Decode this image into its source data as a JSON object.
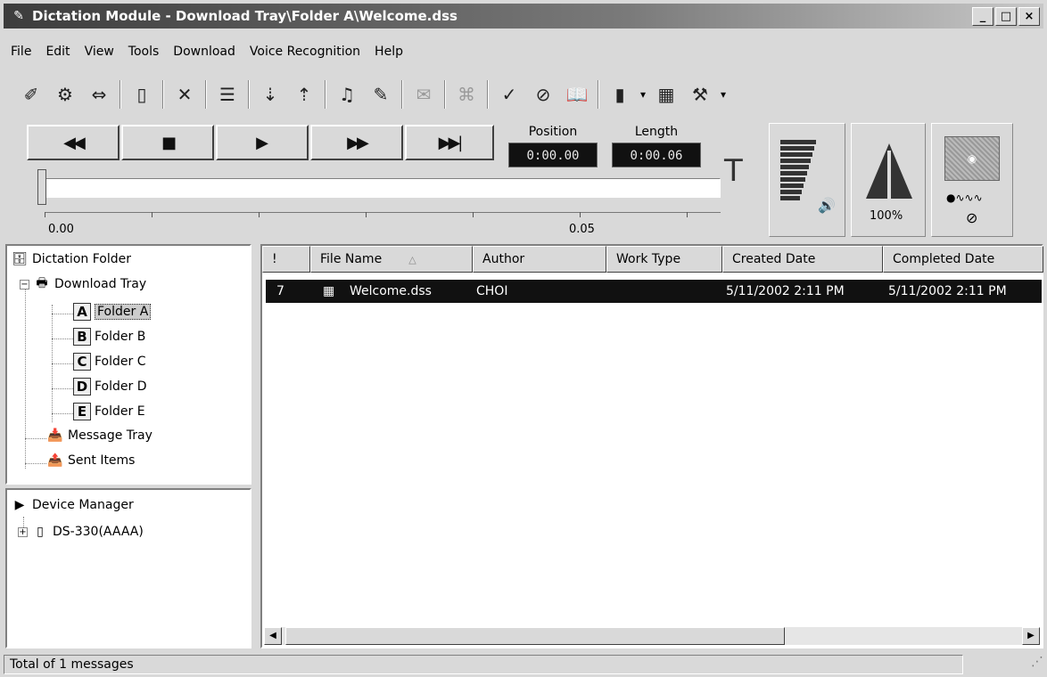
{
  "window": {
    "title": "Dictation Module - Download Tray\\Folder A\\Welcome.dss",
    "min": "_",
    "max": "□",
    "close": "×"
  },
  "menu": [
    "File",
    "Edit",
    "View",
    "Tools",
    "Download",
    "Voice Recognition",
    "Help"
  ],
  "player": {
    "position_label": "Position",
    "position_value": "0:00.00",
    "length_label": "Length",
    "length_value": "0:00.06",
    "scale_start": "0.00",
    "scale_mid": "0.05",
    "speed_value": "100%"
  },
  "tree": {
    "root": "Dictation Folder",
    "download_tray": "Download Tray",
    "folders": [
      {
        "letter": "A",
        "label": "Folder A"
      },
      {
        "letter": "B",
        "label": "Folder B"
      },
      {
        "letter": "C",
        "label": "Folder C"
      },
      {
        "letter": "D",
        "label": "Folder D"
      },
      {
        "letter": "E",
        "label": "Folder E"
      }
    ],
    "message_tray": "Message Tray",
    "sent_items": "Sent Items"
  },
  "devices": {
    "root": "Device Manager",
    "device": "DS-330(AAAA)"
  },
  "list": {
    "columns": [
      "!",
      "File Name",
      "Author",
      "Work Type",
      "Created Date",
      "Completed Date"
    ],
    "rows": [
      {
        "priority": "7",
        "file_name": "Welcome.dss",
        "author": "CHOI",
        "work_type": "",
        "created": "5/11/2002 2:11 PM",
        "completed": "5/11/2002 2:11 PM"
      }
    ]
  },
  "status": "Total of 1 messages"
}
